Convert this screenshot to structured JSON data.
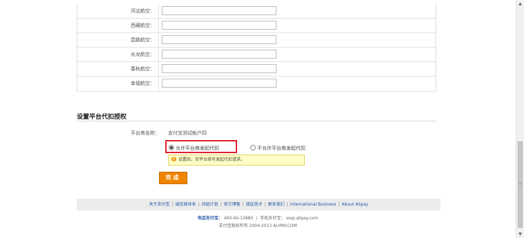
{
  "airlines": [
    {
      "label": "河北航空：",
      "value": ""
    },
    {
      "label": "西藏航空：",
      "value": ""
    },
    {
      "label": "昆鹏航空：",
      "value": ""
    },
    {
      "label": "长龙航空：",
      "value": ""
    },
    {
      "label": "春秋航空：",
      "value": ""
    },
    {
      "label": "幸福航空：",
      "value": ""
    }
  ],
  "authorization": {
    "section_title": "设置平台代扣授权",
    "merchant_label": "平台商名称：",
    "merchant_value": "支付宝测试帐户四",
    "option_allow": "允许平台商发起代扣",
    "option_deny": "不允许平台商发起代扣",
    "selected": "allow",
    "tip_icon": "warning-icon",
    "tip": "设置后，仅平台商可发起代扣请求。",
    "done_label": "完成"
  },
  "footer": {
    "links": [
      "关于支付宝",
      "诚信商体系",
      "诗组计划",
      "官方博客",
      "诚征英才",
      "联系我们",
      "International Business",
      "About Alipay"
    ],
    "hotline_label": "电话支付宝：",
    "hotline": "400-66-13880",
    "mobile_label": "手机支付宝：",
    "mobile": "wap.alipay.com",
    "copyright": "支付宝版权所有 2004-2013 ALIPAY.COM"
  },
  "colors": {
    "accent": "#f08300",
    "highlight": "#e0202a",
    "link": "#1f55a6",
    "tip_bg": "#fffdc4"
  }
}
